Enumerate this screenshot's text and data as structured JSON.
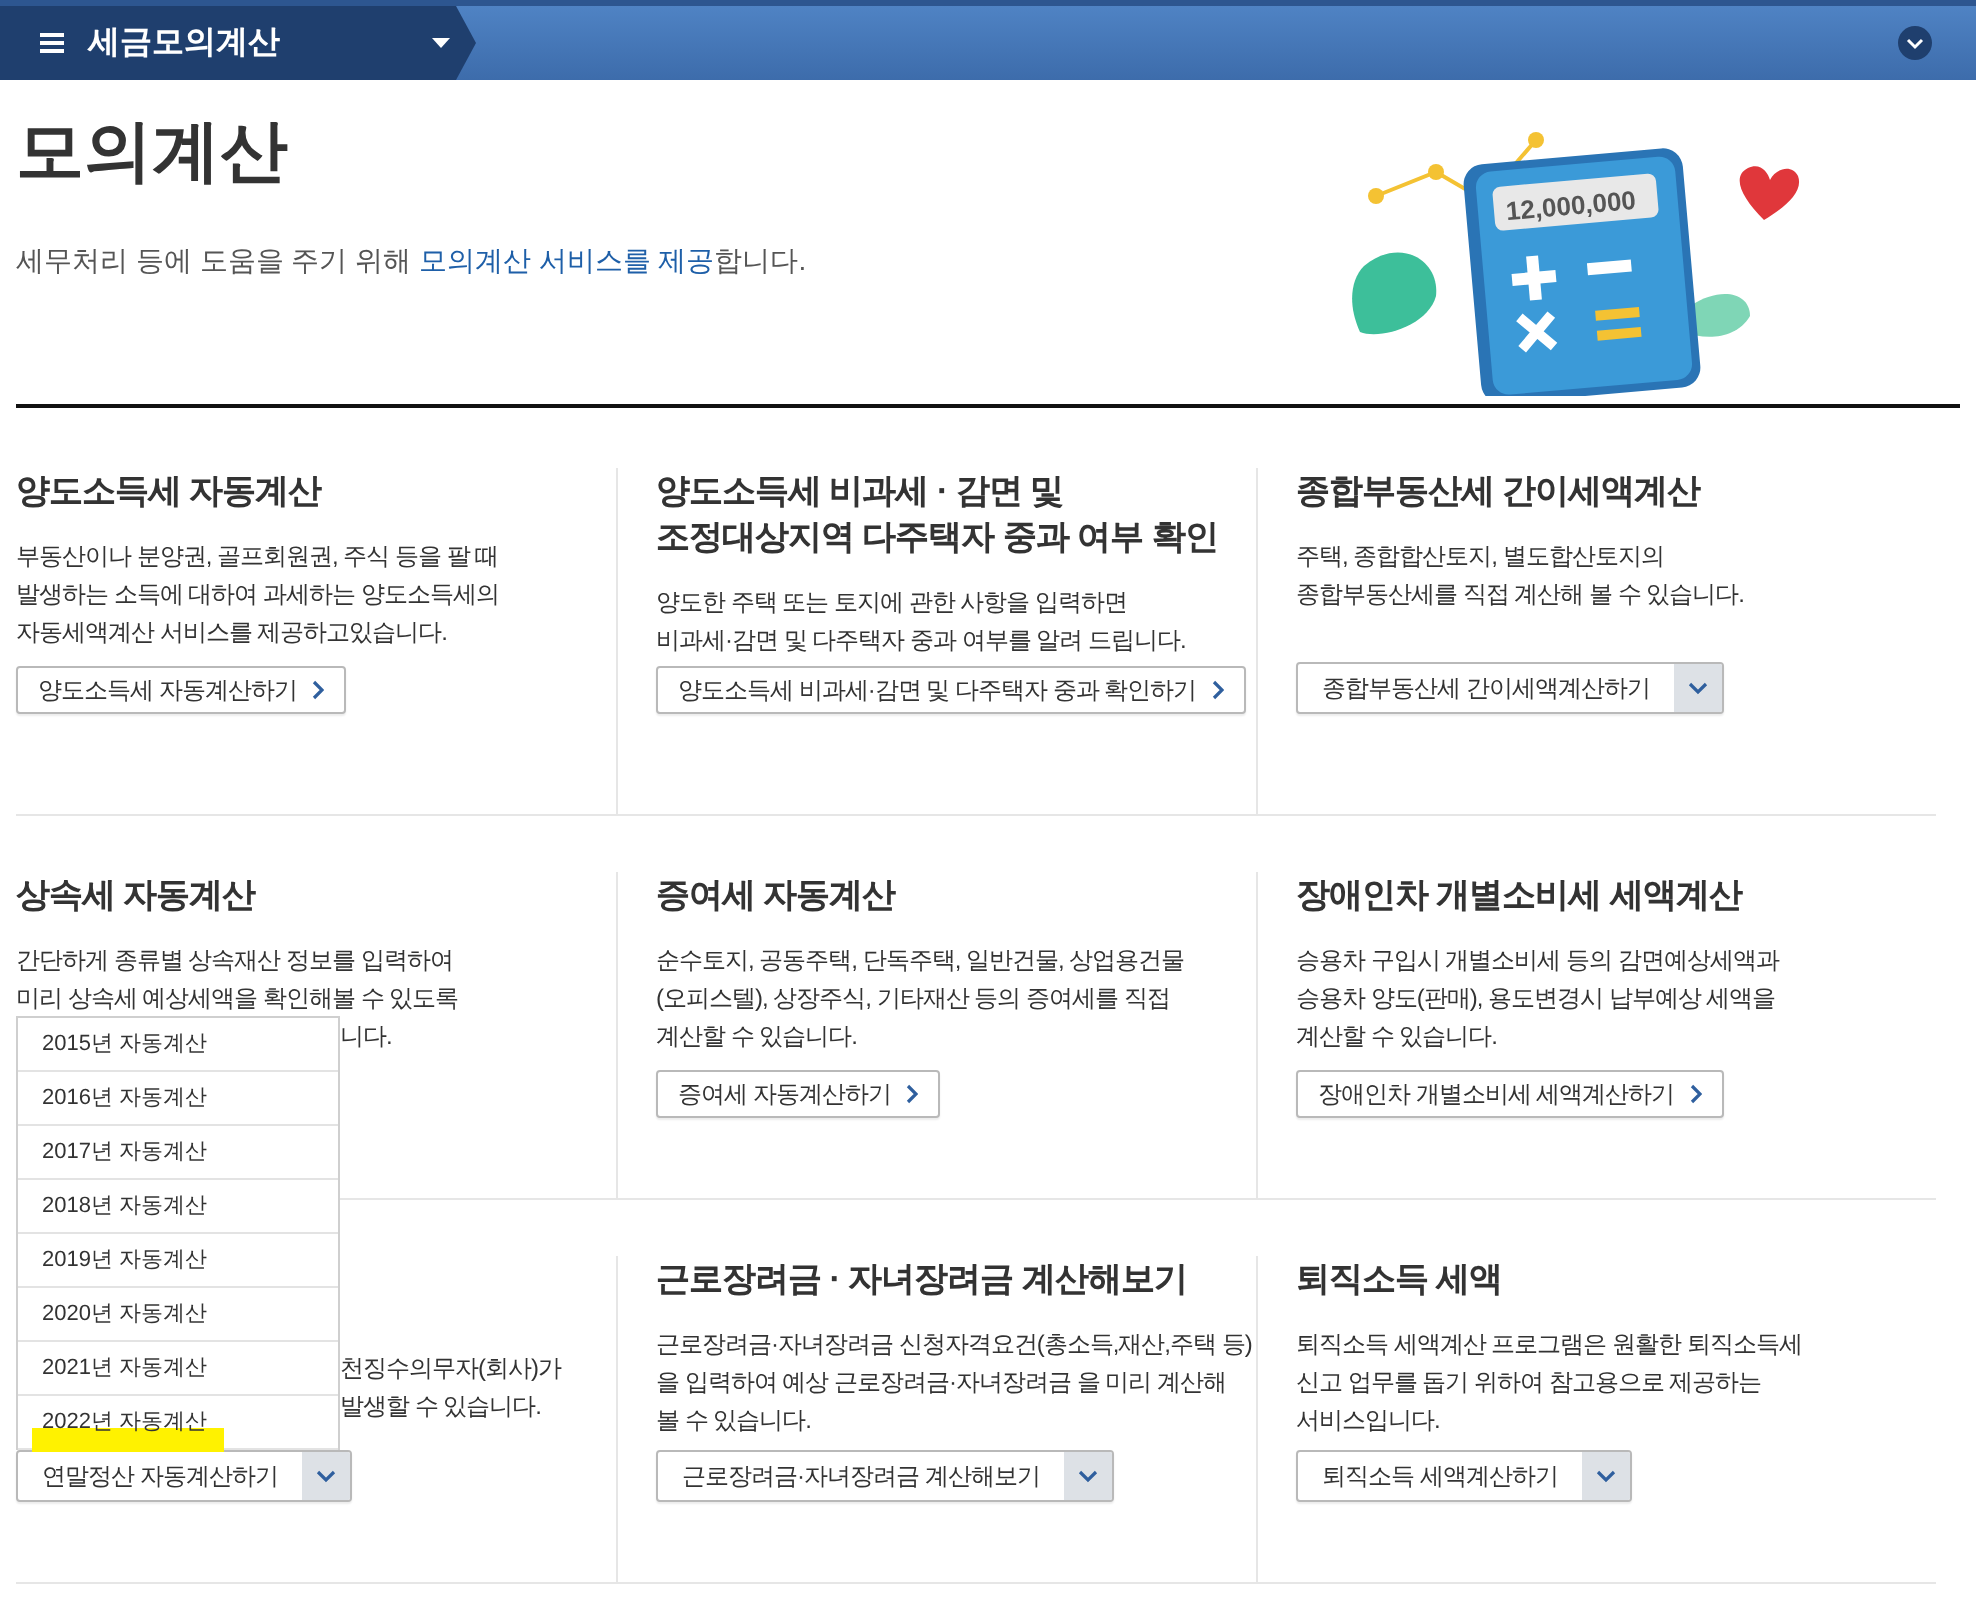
{
  "header": {
    "title": "세금모의계산"
  },
  "page": {
    "title": "모의계산",
    "subtitle_before": "세무처리 등에 도움을 주기 위해 ",
    "subtitle_link": "모의계산 서비스를 제공",
    "subtitle_after": "합니다.",
    "display": "12,000,000"
  },
  "rows": [
    {
      "cards": [
        {
          "title": [
            "양도소득세 자동계산"
          ],
          "lines": [
            {
              "kind": "full",
              "text": "부동산이나 분양권, 골프회원권, 주식 등을 팔 때"
            },
            {
              "kind": "full",
              "text": "발생하는 소득에 대하여 과세하는 양도소득세의"
            },
            {
              "kind": "full",
              "text": "자동세액계산 서비스를 제공하고있습니다."
            }
          ],
          "button": {
            "kind": "link",
            "label": "양도소득세 자동계산하기"
          }
        },
        {
          "title": [
            "양도소득세 비과세 · 감면 및",
            "조정대상지역 다주택자 중과 여부 확인"
          ],
          "lines": [
            {
              "kind": "full",
              "text": "양도한 주택 또는 토지에 관한 사항을 입력하면"
            },
            {
              "kind": "full",
              "text": "비과세·감면 및 다주택자 중과 여부를 알려 드립니다."
            }
          ],
          "button": {
            "kind": "link",
            "label": "양도소득세 비과세·감면 및 다주택자 중과 확인하기"
          }
        },
        {
          "title": [
            "종합부동산세 간이세액계산"
          ],
          "lines": [
            {
              "kind": "full",
              "text": "주택, 종합합산토지, 별도합산토지의"
            },
            {
              "kind": "full",
              "text": "종합부동산세를 직접 계산해 볼 수 있습니다."
            }
          ],
          "button": {
            "kind": "select",
            "label": "종합부동산세 간이세액계산하기"
          }
        }
      ]
    },
    {
      "cards": [
        {
          "title": [
            "상속세 자동계산"
          ],
          "lines": [
            {
              "kind": "full",
              "text": "간단하게 종류별 상속재산 정보를 입력하여"
            },
            {
              "kind": "full",
              "text": "미리 상속세 예상세액을 확인해볼 수 있도록"
            },
            {
              "kind": "partial",
              "text": "니다."
            }
          ]
        },
        {
          "title": [
            "증여세 자동계산"
          ],
          "lines": [
            {
              "kind": "full",
              "text": "순수토지, 공동주택, 단독주택, 일반건물, 상업용건물"
            },
            {
              "kind": "full",
              "text": "(오피스텔), 상장주식, 기타재산 등의 증여세를 직접"
            },
            {
              "kind": "full",
              "text": "계산할 수 있습니다."
            }
          ],
          "button": {
            "kind": "link",
            "label": "증여세 자동계산하기"
          }
        },
        {
          "title": [
            "장애인차 개별소비세 세액계산"
          ],
          "lines": [
            {
              "kind": "full",
              "text": "승용차 구입시 개별소비세 등의 감면예상세액과"
            },
            {
              "kind": "full",
              "text": "승용차 양도(판매), 용도변경시 납부예상 세액을"
            },
            {
              "kind": "full",
              "text": "계산할 수 있습니다."
            }
          ],
          "button": {
            "kind": "link",
            "label": "장애인차 개별소비세 세액계산하기"
          }
        }
      ]
    },
    {
      "cards": [
        {
          "lines": [
            {
              "kind": "partial",
              "text": "천징수의무자(회사)가"
            },
            {
              "kind": "partial",
              "text": "발생할 수 있습니다."
            }
          ],
          "button": {
            "kind": "select",
            "label": "연말정산 자동계산하기",
            "menu": [
              {
                "label": "2015년 자동계산",
                "highlighted": false
              },
              {
                "label": "2016년 자동계산",
                "highlighted": false
              },
              {
                "label": "2017년 자동계산",
                "highlighted": false
              },
              {
                "label": "2018년 자동계산",
                "highlighted": false
              },
              {
                "label": "2019년 자동계산",
                "highlighted": false
              },
              {
                "label": "2020년 자동계산",
                "highlighted": false
              },
              {
                "label": "2021년 자동계산",
                "highlighted": false
              },
              {
                "label": "2022년 자동계산",
                "highlighted": true
              }
            ]
          }
        },
        {
          "title": [
            "근로장려금 · 자녀장려금 계산해보기"
          ],
          "lines": [
            {
              "kind": "full",
              "text": "근로장려금·자녀장려금 신청자격요건(총소득,재산,주택 등)"
            },
            {
              "kind": "full",
              "text": "을 입력하여 예상 근로장려금·자녀장려금 을 미리 계산해"
            },
            {
              "kind": "full",
              "text": "볼 수 있습니다."
            }
          ],
          "button": {
            "kind": "select",
            "label": "근로장려금·자녀장려금 계산해보기"
          }
        },
        {
          "title": [
            "퇴직소득 세액"
          ],
          "lines": [
            {
              "kind": "full",
              "text": "퇴직소득 세액계산 프로그램은 원활한 퇴직소득세"
            },
            {
              "kind": "full",
              "text": "신고 업무를 돕기 위하여 참고용으로 제공하는"
            },
            {
              "kind": "full",
              "text": "서비스입니다."
            }
          ],
          "button": {
            "kind": "select",
            "label": "퇴직소득 세액계산하기"
          }
        }
      ]
    }
  ]
}
